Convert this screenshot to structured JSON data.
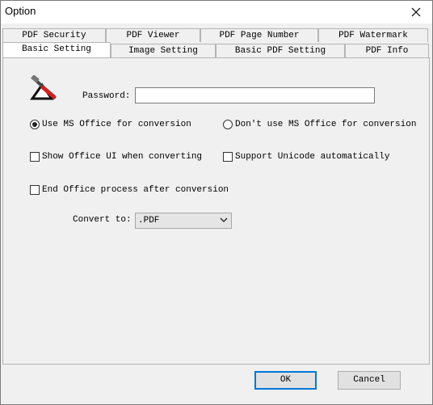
{
  "window": {
    "title": "Option",
    "close_icon": "close-icon"
  },
  "tabs": {
    "row1": [
      "PDF Security",
      "PDF Viewer",
      "PDF Page Number",
      "PDF Watermark"
    ],
    "row2": [
      "Basic Setting",
      "Image Setting",
      "Basic PDF Setting",
      "PDF Info"
    ],
    "active": "Basic Setting"
  },
  "form": {
    "tools_icon": "tools-icon",
    "password_label": "Password:",
    "password_value": "",
    "radio_use_office": "Use MS Office for conversion",
    "radio_no_office": "Don't use MS Office for conversion",
    "use_office_selected": true,
    "show_office_ui": "Show Office UI when converting",
    "show_office_ui_checked": false,
    "support_unicode": "Support Unicode automatically",
    "support_unicode_checked": false,
    "end_office_process": "End Office process after conversion",
    "end_office_process_checked": false,
    "convert_to_label": "Convert to:",
    "convert_to_value": ".PDF"
  },
  "buttons": {
    "ok": "OK",
    "cancel": "Cancel"
  },
  "colors": {
    "accent": "#0078d7",
    "tools_red": "#cc2222"
  }
}
